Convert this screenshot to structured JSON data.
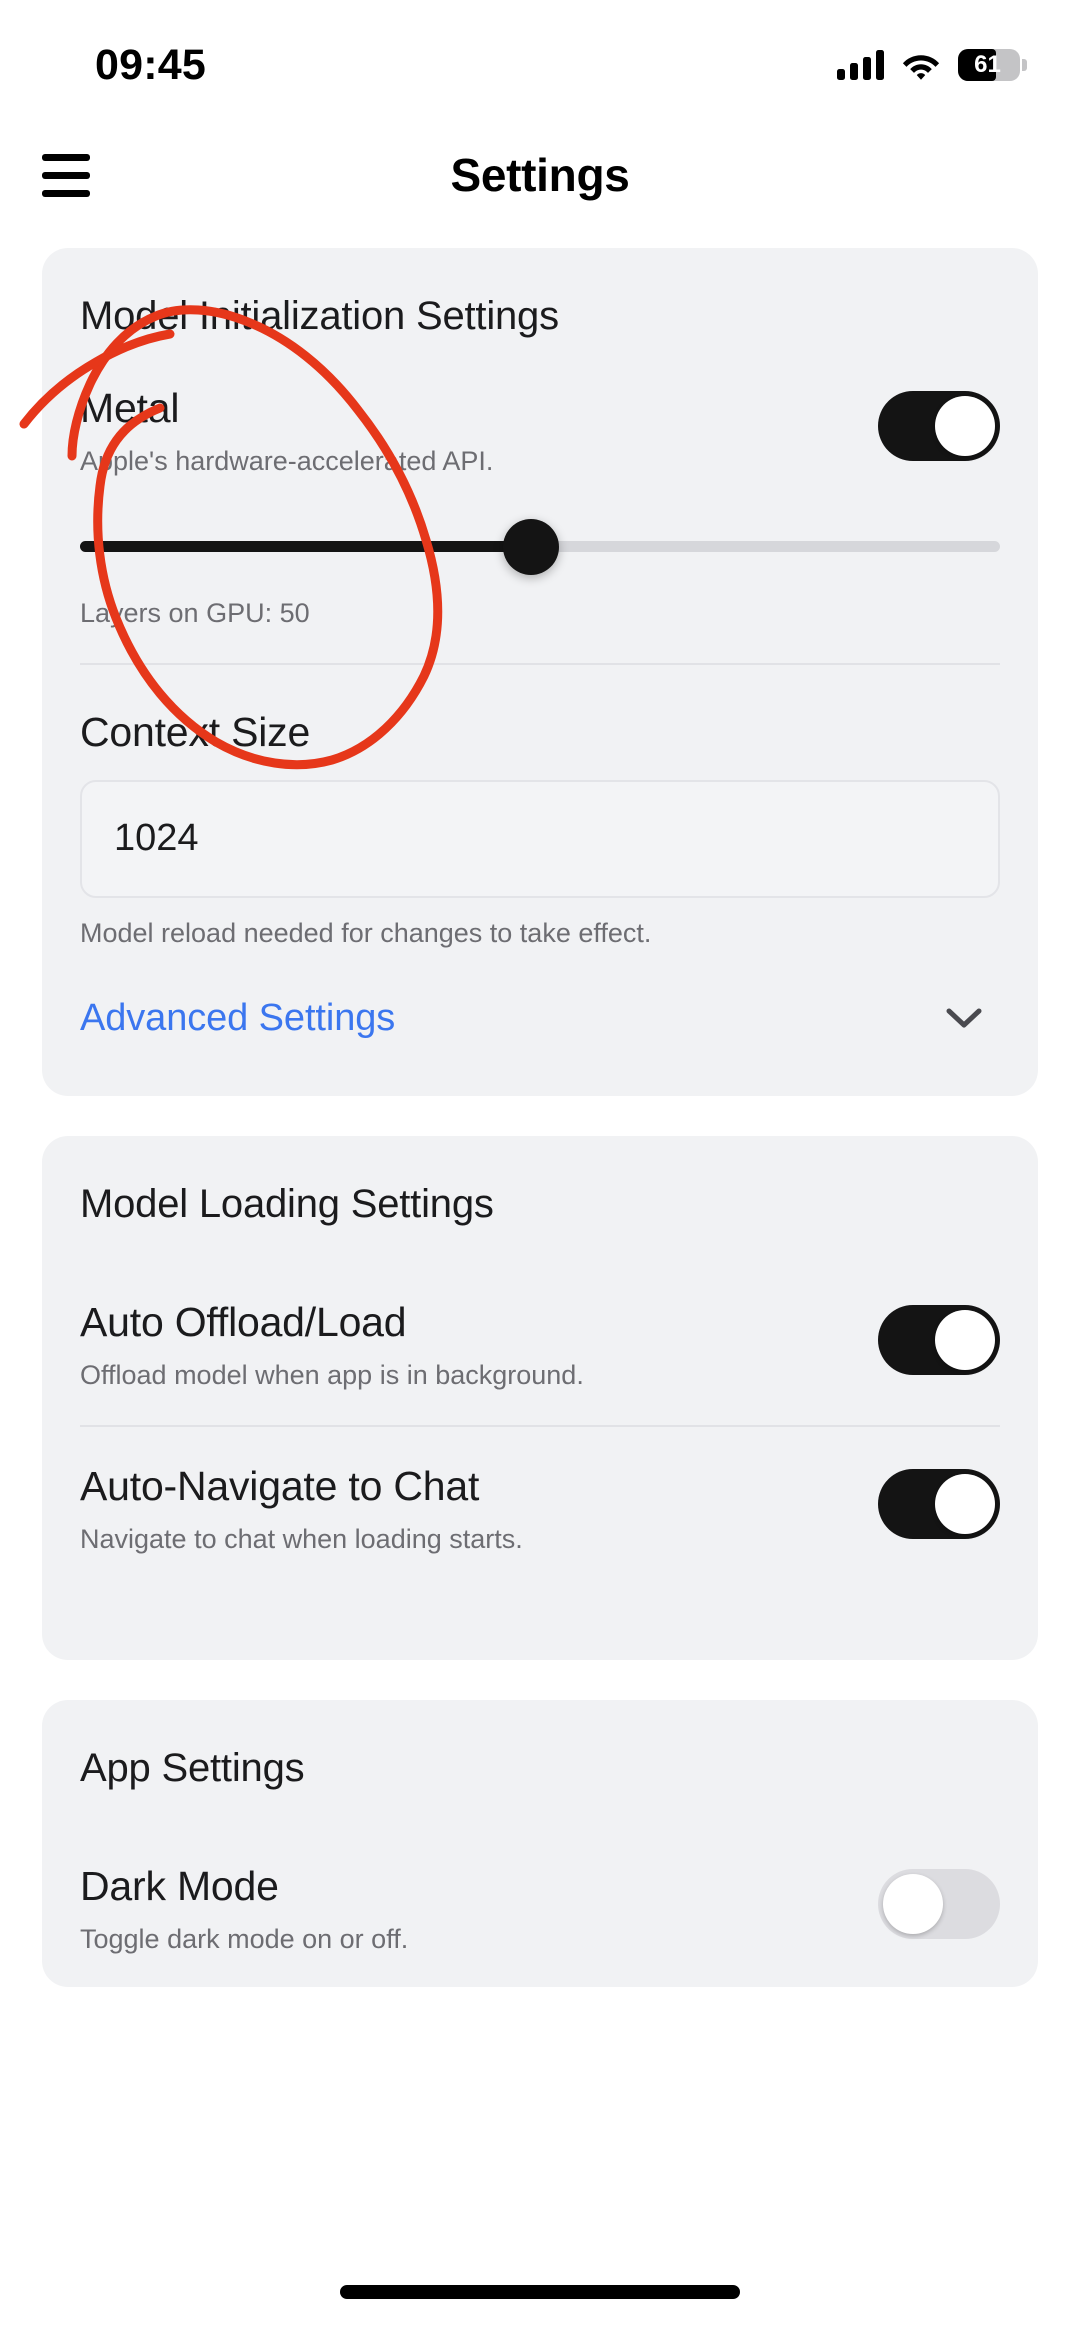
{
  "status_bar": {
    "time": "09:45",
    "signal_icon": "cellular-signal-icon",
    "wifi_icon": "wifi-icon",
    "battery_percent": "61",
    "battery_level": 61
  },
  "nav": {
    "menu_icon": "hamburger-menu-icon",
    "title": "Settings"
  },
  "annotation": {
    "color": "#e6371a",
    "shape": "hand-drawn-circle",
    "target": "Metal"
  },
  "colors": {
    "card_background": "#f1f2f4",
    "page_background": "#ffffff",
    "toggle_on": "#141414",
    "toggle_off": "#dcdce0",
    "link_blue": "#3b76ef",
    "text_primary": "#1b1b1d",
    "text_secondary": "#6d6d72",
    "annotation_red": "#e6371a"
  },
  "sections": [
    {
      "title": "Model Initialization Settings",
      "metal": {
        "title": "Metal",
        "subtitle": "Apple's hardware-accelerated API.",
        "toggle_state": "on",
        "toggle_label": "Metal toggle"
      },
      "gpu_slider": {
        "caption": "Layers on GPU: 50",
        "value": 50,
        "min": 0,
        "max": 100,
        "percent": 49
      },
      "context_size": {
        "label": "Context Size",
        "value": "1024",
        "placeholder": "Enter context size",
        "help": "Model reload needed for changes to take effect."
      },
      "advanced": {
        "label": "Advanced Settings",
        "expand_icon": "chevron-down-icon",
        "expanded": false
      }
    },
    {
      "title": "Model Loading Settings",
      "rows": [
        {
          "title": "Auto Offload/Load",
          "subtitle": "Offload model when app is in background.",
          "toggle_state": "on"
        },
        {
          "title": "Auto-Navigate to Chat",
          "subtitle": "Navigate to chat when loading starts.",
          "toggle_state": "on"
        }
      ]
    },
    {
      "title": "App Settings",
      "rows": [
        {
          "title": "Dark Mode",
          "subtitle": "Toggle dark mode on or off.",
          "toggle_state": "off"
        }
      ]
    }
  ]
}
